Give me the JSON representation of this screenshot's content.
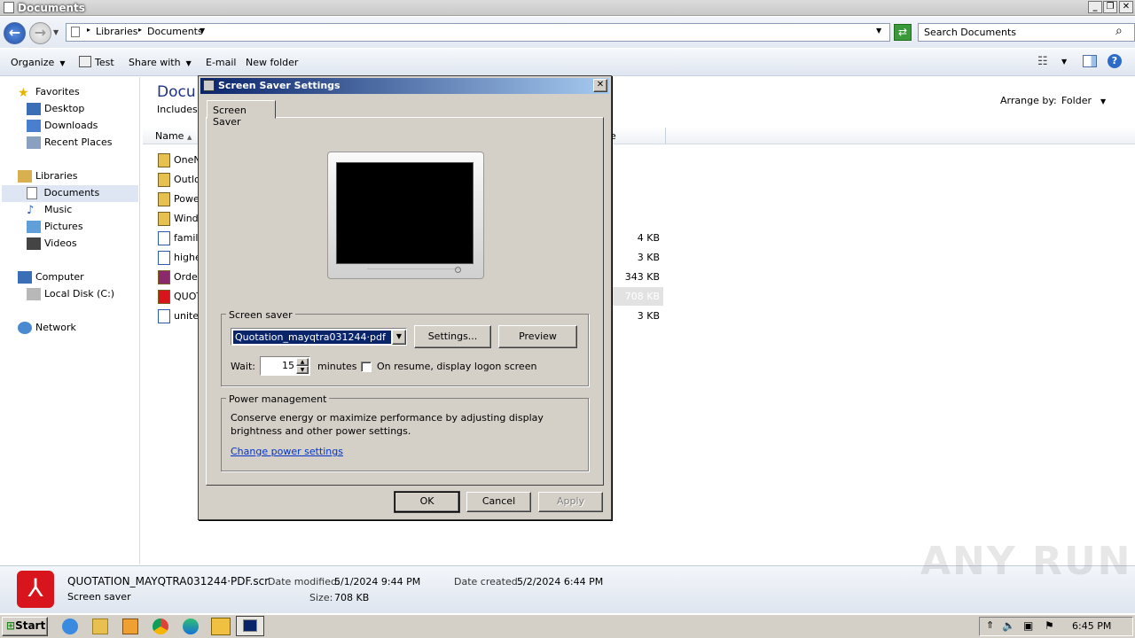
{
  "window": {
    "title": "Documents"
  },
  "address": {
    "crumb1": "Libraries",
    "crumb2": "Documents",
    "search_placeholder": "Search Documents"
  },
  "toolbar": {
    "organize": "Organize",
    "test": "Test",
    "share_with": "Share with",
    "email": "E-mail",
    "new_folder": "New folder"
  },
  "nav": {
    "favorites": "Favorites",
    "desktop": "Desktop",
    "downloads": "Downloads",
    "recent": "Recent Places",
    "libraries": "Libraries",
    "documents": "Documents",
    "music": "Music",
    "pictures": "Pictures",
    "videos": "Videos",
    "computer": "Computer",
    "local_disk": "Local Disk (C:)",
    "network": "Network"
  },
  "content": {
    "title": "Docu",
    "includes": "Includes:",
    "arrange_label": "Arrange by:",
    "arrange_value": "Folder",
    "col_name": "Name",
    "col_size_frag": "e",
    "files": [
      {
        "name": "OneN",
        "size": ""
      },
      {
        "name": "Outlo",
        "size": ""
      },
      {
        "name": "Powe",
        "size": ""
      },
      {
        "name": "Windo",
        "size": ""
      },
      {
        "name": "family",
        "size": "4 KB"
      },
      {
        "name": "highe",
        "size": "3 KB"
      },
      {
        "name": "Order",
        "size": "343 KB"
      },
      {
        "name": "QUOT",
        "size": "708 KB"
      },
      {
        "name": "unite",
        "size": "3 KB"
      }
    ]
  },
  "details": {
    "filename": "QUOTATION_MAYQTRA031244·PDF.scr",
    "type": "Screen saver",
    "modified_label": "Date modified:",
    "modified_value": "5/1/2024 9:44 PM",
    "created_label": "Date created:",
    "created_value": "5/2/2024 6:44 PM",
    "size_label": "Size:",
    "size_value": "708 KB"
  },
  "dialog": {
    "title": "Screen Saver Settings",
    "tab": "Screen Saver",
    "group_saver": "Screen saver",
    "saver_value": "Quotation_mayqtra031244·pdf",
    "settings_btn": "Settings...",
    "preview_btn": "Preview",
    "wait_label": "Wait:",
    "wait_value": "15",
    "minutes_label": "minutes",
    "resume_label": "On resume, display logon screen",
    "group_power": "Power management",
    "power_text1": "Conserve energy or maximize performance by adjusting display",
    "power_text2": "brightness and other power settings.",
    "power_link": "Change power settings",
    "ok": "OK",
    "cancel": "Cancel",
    "apply": "Apply"
  },
  "taskbar": {
    "start": "Start",
    "clock": "6:45 PM"
  },
  "watermark": "ANY RUN"
}
